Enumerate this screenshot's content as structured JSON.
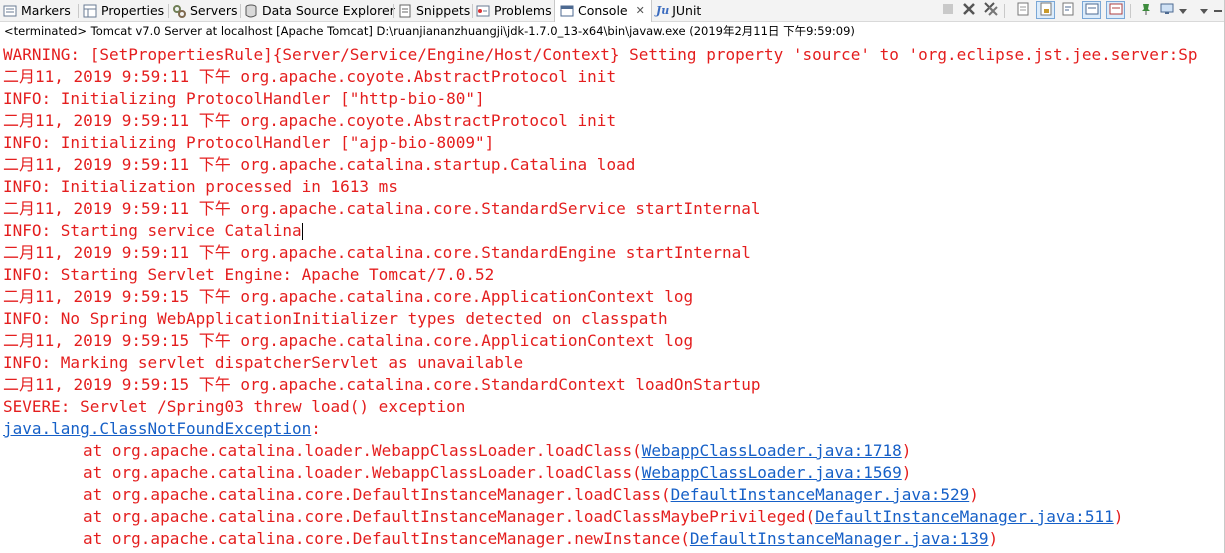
{
  "tabs": [
    {
      "label": "Markers",
      "icon": "markers-icon"
    },
    {
      "label": "Properties",
      "icon": "properties-icon"
    },
    {
      "label": "Servers",
      "icon": "servers-icon"
    },
    {
      "label": "Data Source Explorer",
      "icon": "data-source-icon"
    },
    {
      "label": "Snippets",
      "icon": "snippets-icon"
    },
    {
      "label": "Problems",
      "icon": "problems-icon"
    },
    {
      "label": "Console",
      "icon": "console-icon",
      "active": true,
      "close": "✕"
    },
    {
      "label": "JUnit",
      "icon": "junit-icon",
      "badge": "Ju"
    }
  ],
  "status": "<terminated> Tomcat v7.0 Server at localhost [Apache Tomcat] D:\\ruanjiananzhuangji\\jdk-1.7.0_13-x64\\bin\\javaw.exe (2019年2月11日 下午9:59:09)",
  "console_lines": [
    {
      "text": "WARNING: [SetPropertiesRule]{Server/Service/Engine/Host/Context} Setting property 'source' to 'org.eclipse.jst.jee.server:Sp"
    },
    {
      "text": "二月11, 2019 9:59:11 下午 org.apache.coyote.AbstractProtocol init"
    },
    {
      "text": "INFO: Initializing ProtocolHandler [\"http-bio-80\"]"
    },
    {
      "text": "二月11, 2019 9:59:11 下午 org.apache.coyote.AbstractProtocol init"
    },
    {
      "text": "INFO: Initializing ProtocolHandler [\"ajp-bio-8009\"]"
    },
    {
      "text": "二月11, 2019 9:59:11 下午 org.apache.catalina.startup.Catalina load"
    },
    {
      "text": "INFO: Initialization processed in 1613 ms"
    },
    {
      "text": "二月11, 2019 9:59:11 下午 org.apache.catalina.core.StandardService startInternal"
    },
    {
      "text": "INFO: Starting service Catalina",
      "cursor": true
    },
    {
      "text": "二月11, 2019 9:59:11 下午 org.apache.catalina.core.StandardEngine startInternal"
    },
    {
      "text": "INFO: Starting Servlet Engine: Apache Tomcat/7.0.52"
    },
    {
      "text": "二月11, 2019 9:59:15 下午 org.apache.catalina.core.ApplicationContext log"
    },
    {
      "text": "INFO: No Spring WebApplicationInitializer types detected on classpath"
    },
    {
      "text": "二月11, 2019 9:59:15 下午 org.apache.catalina.core.ApplicationContext log"
    },
    {
      "text": "INFO: Marking servlet dispatcherServlet as unavailable"
    },
    {
      "text": "二月11, 2019 9:59:15 下午 org.apache.catalina.core.StandardContext loadOnStartup"
    },
    {
      "text": "SEVERE: Servlet /Spring03 threw load() exception"
    },
    {
      "link": "java.lang.ClassNotFoundException",
      "text": ":"
    },
    {
      "text": "\tat org.apache.catalina.loader.WebappClassLoader.loadClass(",
      "link": "WebappClassLoader.java:1718",
      "after": ")"
    },
    {
      "text": "\tat org.apache.catalina.loader.WebappClassLoader.loadClass(",
      "link": "WebappClassLoader.java:1569",
      "after": ")"
    },
    {
      "text": "\tat org.apache.catalina.core.DefaultInstanceManager.loadClass(",
      "link": "DefaultInstanceManager.java:529",
      "after": ")"
    },
    {
      "text": "\tat org.apache.catalina.core.DefaultInstanceManager.loadClassMaybePrivileged(",
      "link": "DefaultInstanceManager.java:511",
      "after": ")"
    },
    {
      "text": "\tat org.apache.catalina.core.DefaultInstanceManager.newInstance(",
      "link": "DefaultInstanceManager.java:139",
      "after": ")"
    }
  ],
  "colors": {
    "error_text": "#e41e1e",
    "link": "#1660c7"
  }
}
